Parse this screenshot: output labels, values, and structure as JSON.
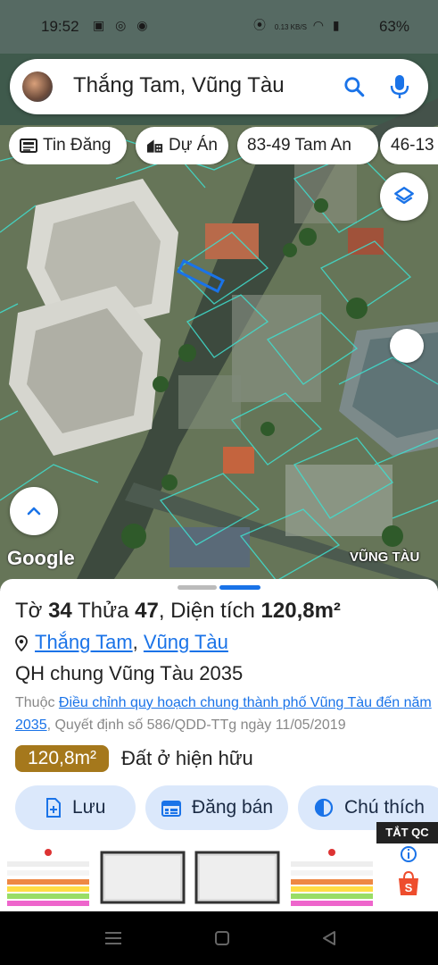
{
  "status_bar": {
    "time": "19:52",
    "battery": "63%",
    "data_rate": "0.13 KB/S"
  },
  "search": {
    "query": "Thắng Tam, Vũng Tàu"
  },
  "chips": [
    {
      "label": "Tin Đăng",
      "icon": "newspaper-icon"
    },
    {
      "label": "Dự Án",
      "icon": "building-icon"
    },
    {
      "label": "83-49 Tam An",
      "icon": ""
    },
    {
      "label": "46-13",
      "icon": ""
    }
  ],
  "map": {
    "google_logo": "Google",
    "city_label": "VŨNG TÀU"
  },
  "parcel": {
    "to_label": "Tờ",
    "to_value": "34",
    "thua_label": "Thửa",
    "thua_value": "47",
    "dien_tich_label": ", Diện tích",
    "area": "120,8m²",
    "ward": "Thắng Tam",
    "city": "Vũng Tàu",
    "plan_title": "QH chung Vũng Tàu 2035",
    "plan_prefix": "Thuộc",
    "plan_link": "Điều chỉnh quy hoạch chung thành phố Vũng Tàu đến năm 2035",
    "plan_decision": ", Quyết định số 586/QDD-TTg ngày 11/05/2019",
    "area_badge": "120,8m²",
    "land_use": "Đất ở hiện hữu"
  },
  "actions": {
    "save": "Lưu",
    "post_sale": "Đăng bán",
    "legend": "Chú thích"
  },
  "ad": {
    "close_label": "TẮT QC"
  },
  "colors": {
    "accent": "#1a73e8",
    "badge": "#a5781c",
    "action_bg": "#dbe8fb"
  }
}
